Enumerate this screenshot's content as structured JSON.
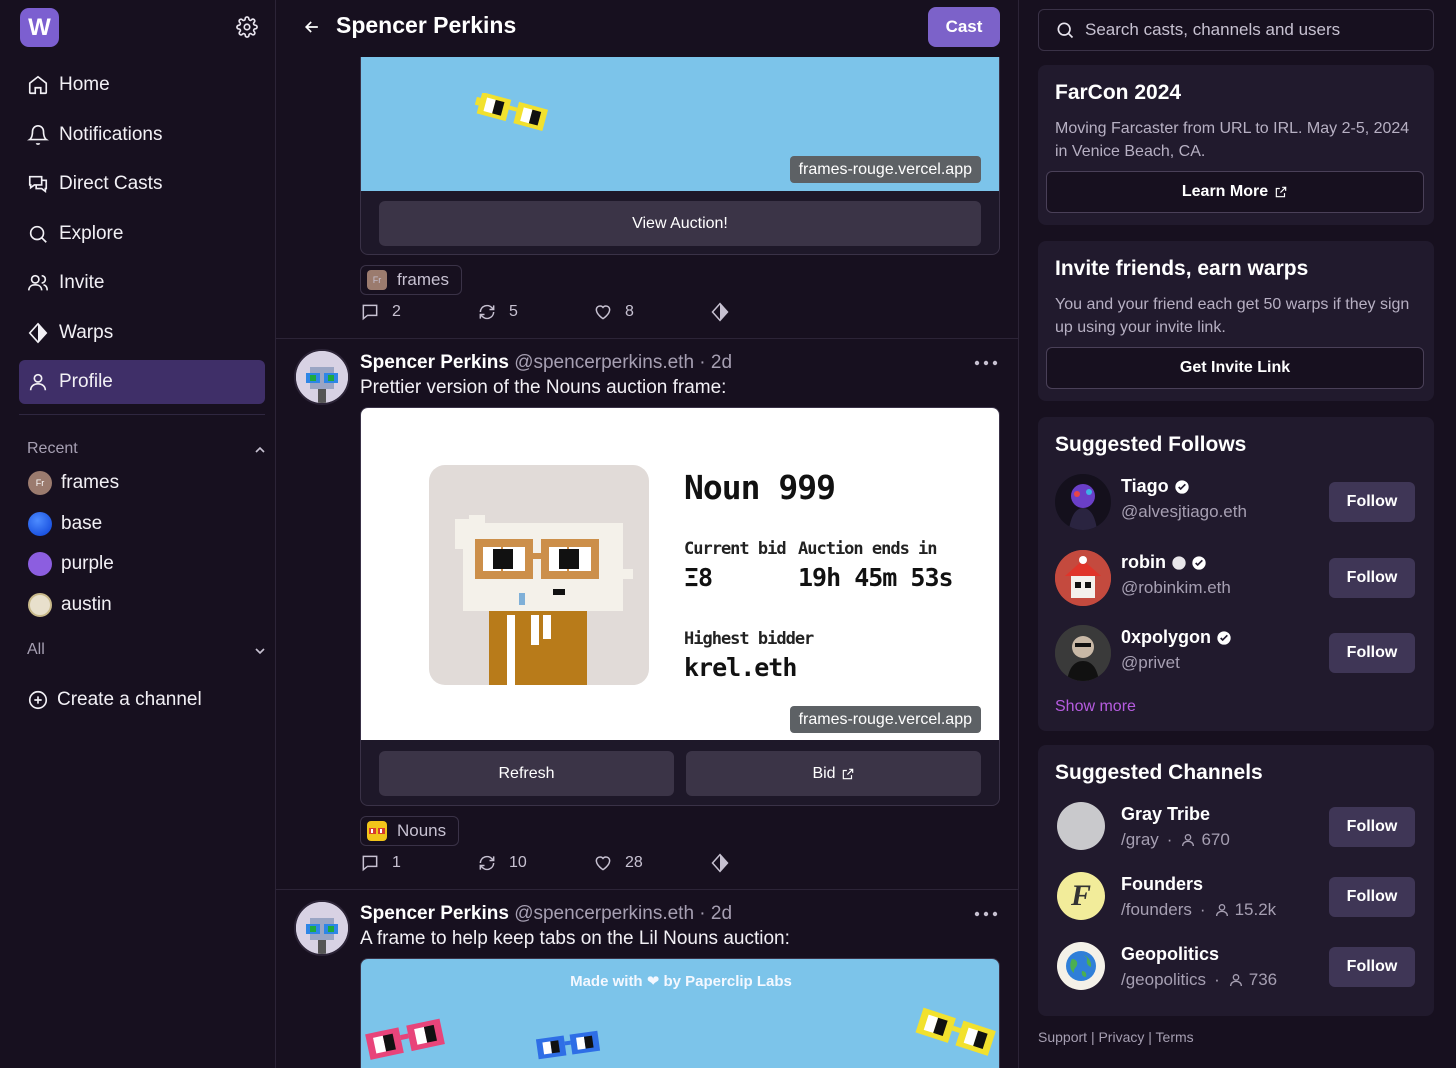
{
  "sidebar": {
    "logo": "W",
    "nav": [
      {
        "label": "Home",
        "icon": "home-icon"
      },
      {
        "label": "Notifications",
        "icon": "bell-icon"
      },
      {
        "label": "Direct Casts",
        "icon": "chat-icon"
      },
      {
        "label": "Explore",
        "icon": "search-icon"
      },
      {
        "label": "Invite",
        "icon": "users-icon"
      },
      {
        "label": "Warps",
        "icon": "diamond-icon"
      },
      {
        "label": "Profile",
        "icon": "user-icon"
      }
    ],
    "recent_label": "Recent",
    "recent": [
      {
        "label": "frames",
        "avatar_text": "Fr",
        "color": "#9b7b6e"
      },
      {
        "label": "base",
        "color": "#1a5ff0"
      },
      {
        "label": "purple",
        "color": "#8c5ee0"
      },
      {
        "label": "austin",
        "color": "#e8e0cc"
      }
    ],
    "all_label": "All",
    "create_channel": "Create a channel"
  },
  "main": {
    "title": "Spencer Perkins",
    "cast_button": "Cast",
    "post0": {
      "frame_url": "frames-rouge.vercel.app",
      "frame_button": "View Auction!",
      "channel": "frames",
      "channel_avatar": "Fr",
      "replies": "2",
      "recasts": "5",
      "likes": "8"
    },
    "post1": {
      "author": "Spencer Perkins",
      "meta": "@spencerperkins.eth · 2d",
      "text": "Prettier version of the Nouns auction frame:",
      "noun_title": "Noun 999",
      "current_bid_label": "Current bid",
      "current_bid": "Ξ8",
      "auction_ends_label": "Auction ends in",
      "auction_ends": "19h 45m 53s",
      "highest_bidder_label": "Highest bidder",
      "highest_bidder": "krel.eth",
      "frame_url": "frames-rouge.vercel.app",
      "button_refresh": "Refresh",
      "button_bid": "Bid",
      "channel": "Nouns",
      "replies": "1",
      "recasts": "10",
      "likes": "28"
    },
    "post2": {
      "author": "Spencer Perkins",
      "meta": "@spencerperkins.eth · 2d",
      "text": "A frame to help keep tabs on the Lil Nouns auction:",
      "frame_caption": "Made with ❤ by Paperclip Labs"
    }
  },
  "right": {
    "search_placeholder": "Search casts, channels and users",
    "farcon": {
      "title": "FarCon 2024",
      "text": "Moving Farcaster from URL to IRL. May 2-5, 2024 in Venice Beach, CA.",
      "button": "Learn More"
    },
    "invite": {
      "title": "Invite friends, earn warps",
      "text": "You and your friend each get 50 warps if they sign up using your invite link.",
      "button": "Get Invite Link"
    },
    "suggested_follows": {
      "title": "Suggested Follows",
      "users": [
        {
          "name": "Tiago",
          "handle": "@alvesjtiago.eth",
          "button": "Follow"
        },
        {
          "name": "robin",
          "handle": "@robinkim.eth",
          "button": "Follow"
        },
        {
          "name": "0xpolygon",
          "handle": "@privet",
          "button": "Follow"
        }
      ],
      "show_more": "Show more"
    },
    "suggested_channels": {
      "title": "Suggested Channels",
      "channels": [
        {
          "name": "Gray Tribe",
          "handle": "/gray",
          "members": "670",
          "button": "Follow",
          "color": "#c9c9cc"
        },
        {
          "name": "Founders",
          "handle": "/founders",
          "members": "15.2k",
          "button": "Follow",
          "color": "#f2ec9a"
        },
        {
          "name": "Geopolitics",
          "handle": "/geopolitics",
          "members": "736",
          "button": "Follow",
          "color": "#f4f1e8"
        }
      ]
    },
    "footer": {
      "support": "Support",
      "privacy": "Privacy",
      "terms": "Terms",
      "sep": "|"
    }
  }
}
